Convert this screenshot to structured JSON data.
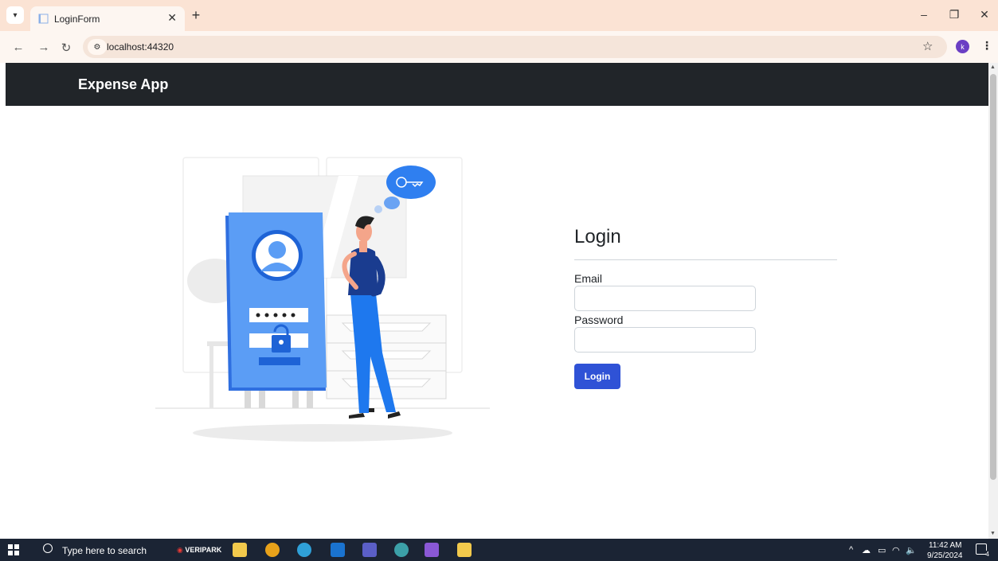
{
  "browser": {
    "tab_title": "LoginForm",
    "url": "localhost:44320",
    "profile_initial": "k"
  },
  "app": {
    "brand": "Expense App"
  },
  "login": {
    "heading": "Login",
    "email_label": "Email",
    "email_value": "",
    "password_label": "Password",
    "password_value": "",
    "submit_label": "Login"
  },
  "taskbar": {
    "search_placeholder": "Type here to search",
    "veripark_label": "VERIPARK",
    "time": "11:42 AM",
    "date": "9/25/2024",
    "notification_count": "4"
  },
  "colors": {
    "navbar_bg": "#212529",
    "primary_button": "#2f52d6",
    "illustration_blue": "#4b8ff3",
    "browser_frame": "#fbe3d4"
  },
  "icons": [
    "tab-search-icon",
    "page-favicon",
    "close-icon",
    "plus-icon",
    "back-icon",
    "forward-icon",
    "reload-icon",
    "site-info-icon",
    "star-icon",
    "profile-avatar",
    "menu-icon",
    "windows-start-icon",
    "search-icon",
    "file-explorer-icon",
    "chrome-icon",
    "edge-icon",
    "outlook-icon",
    "teams-icon",
    "visual-studio-icon",
    "notification-icon"
  ]
}
